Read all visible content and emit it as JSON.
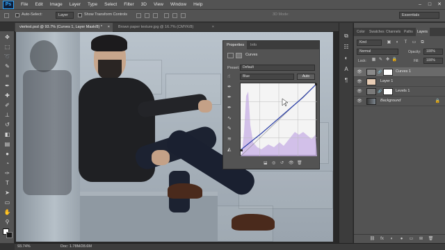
{
  "app": {
    "logo": "Ps",
    "menu": [
      "File",
      "Edit",
      "Image",
      "Layer",
      "Type",
      "Select",
      "Filter",
      "3D",
      "View",
      "Window",
      "Help"
    ],
    "window_controls": [
      "–",
      "□",
      "✕"
    ]
  },
  "options_bar": {
    "auto_select_label": "Auto-Select:",
    "auto_select_value": "Layer",
    "show_transform_label": "Show Transform Controls",
    "mode_3d_label": "3D Mode:",
    "workspace": "Essentials"
  },
  "tabs": {
    "doc1": "vierlest.psd @ 93.7% (Curves 1, Layer Mask/8) *",
    "doc1_close": "×",
    "doc2": "Brown paper texture.jpg @ 16.7% (CMYK/8)",
    "doc2_close": "×"
  },
  "properties": {
    "tab_properties": "Properties",
    "tab_info": "Info",
    "title": "Curves",
    "preset_label": "Preset:",
    "preset_value": "Default",
    "channel_value": "Blue",
    "auto_button": "Auto"
  },
  "layers_panel": {
    "tabs": [
      "Color",
      "Swatches",
      "Channels",
      "Paths",
      "Layers"
    ],
    "filter_kind": "Kind",
    "blend_mode": "Normal",
    "opacity_label": "Opacity:",
    "opacity_value": "100%",
    "lock_label": "Lock:",
    "fill_label": "Fill:",
    "fill_value": "100%",
    "layers": [
      {
        "name": "Curves 1",
        "selected": true,
        "thumb_color": "#7a7a7a",
        "has_mask": true
      },
      {
        "name": "Layer 1",
        "selected": false,
        "thumb_color": "#e8cdb5",
        "has_mask": false
      },
      {
        "name": "Levels 1",
        "selected": false,
        "thumb_color": "#7a7a7a",
        "has_mask": true
      },
      {
        "name": "Background",
        "selected": false,
        "thumb_color": "#4a4a4a",
        "has_mask": false,
        "italic": true
      }
    ],
    "footer_icons": [
      "fx",
      "◐",
      "●",
      "▭",
      "⊞",
      "🗑"
    ]
  },
  "status": {
    "zoom": "93.74%",
    "doc": "Doc: 1.78M/28.6M"
  },
  "colors": {
    "ui_dark": "#323232",
    "ui_panel": "#535353",
    "accent_blue": "#31a8ff",
    "curve_line": "#2b3fa8",
    "histogram": "#c9b3e6"
  }
}
